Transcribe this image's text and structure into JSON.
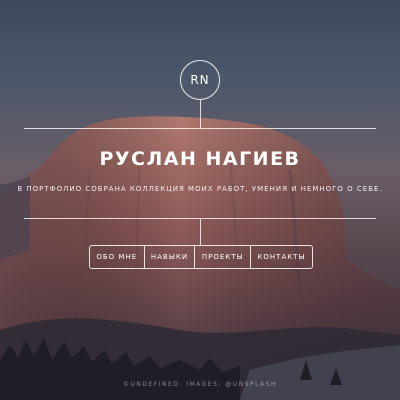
{
  "logo": {
    "initials": "RN"
  },
  "hero": {
    "name": "РУСЛАН НАГИЕВ",
    "description": "В ПОРТФОЛИО СОБРАНА КОЛЛЕКЦИЯ МОИХ РАБОТ, УМЕНИЯ И НЕМНОГО О СЕБЕ."
  },
  "nav": {
    "items": [
      {
        "label": "ОБО МНЕ"
      },
      {
        "label": "НАВЫКИ"
      },
      {
        "label": "ПРОЕКТЫ"
      },
      {
        "label": "КОНТАКТЫ"
      }
    ]
  },
  "footer": {
    "credit": "©UNDEFINED. IMAGES: @UNSPLASH"
  },
  "colors": {
    "sky_top": "#3d4a5c",
    "rock": "#8a5a55",
    "foreground": "#2e2c36",
    "text": "#ffffff"
  }
}
